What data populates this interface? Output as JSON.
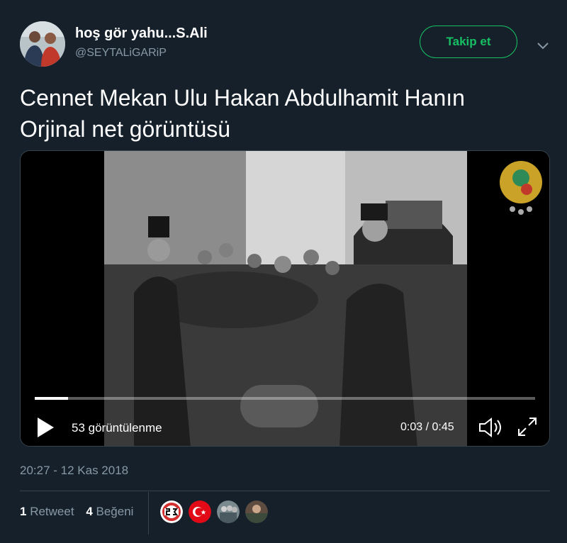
{
  "author": {
    "display_name": "hoş gör yahu...S.Ali",
    "username": "@SEYTALiGARiP"
  },
  "follow_button": {
    "label": "Takip et"
  },
  "tweet": {
    "text_line1": "Cennet Mekan Ulu Hakan Abdulhamit Hanın",
    "text_line2": "Orjinal net görüntüsü"
  },
  "video": {
    "views_label": "53 görüntülenme",
    "time_label": "0:03 / 0:45",
    "progress_fraction": 0.067
  },
  "timestamp": "20:27 - 12 Kas 2018",
  "stats": {
    "retweet_count": "1",
    "retweet_label": "Retweet",
    "like_count": "4",
    "like_label": "Beğeni"
  },
  "likers": [
    "avatar-53",
    "turkish-flag-avatar",
    "group-photo-avatar",
    "photo-avatar"
  ],
  "colors": {
    "background": "#15202b",
    "accent_green": "#17bf63",
    "secondary_text": "#8899a6",
    "divider": "#38444d"
  },
  "icons": [
    "chevron-down-icon",
    "play-icon",
    "volume-icon",
    "fullscreen-icon"
  ]
}
